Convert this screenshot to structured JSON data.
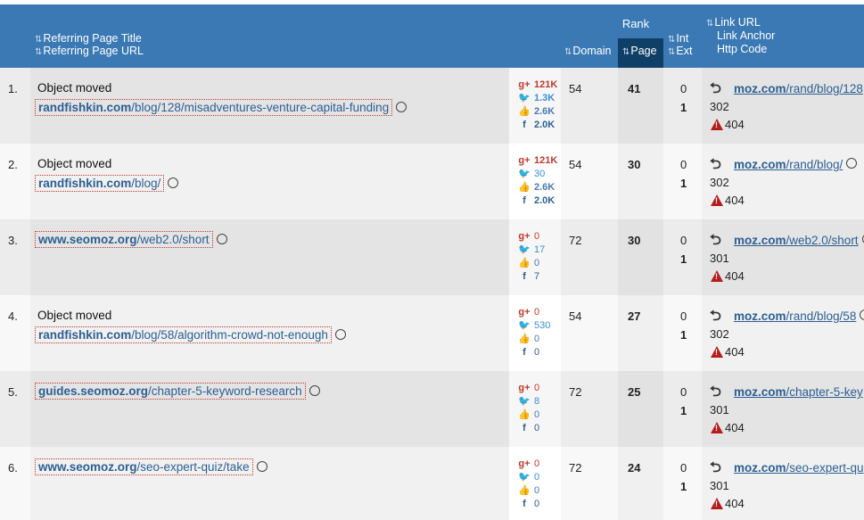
{
  "header": {
    "rank": "Rank",
    "title_label": "Referring Page Title",
    "url_label": "Referring Page URL",
    "domain": "Domain",
    "page": "Page",
    "int": "Int",
    "ext": "Ext",
    "link_url": "Link URL",
    "link_anchor": "Link Anchor",
    "http_code": "Http Code",
    "sort_glyph": "⇅"
  },
  "rows": [
    {
      "num": "1.",
      "title": "Object moved",
      "url_domain": "randfishkin.com",
      "url_path": "/blog/128/misadventures-venture-capital-funding",
      "gplus": "121K",
      "twitter": "1.3K",
      "likes": "2.6K",
      "facebook": "2.0K",
      "domain_rank": "54",
      "page_rank": "41",
      "int": "0",
      "ext": "1",
      "link_domain": "moz.com",
      "link_path": "/rand/blog/128",
      "code": "302",
      "target_code": "404"
    },
    {
      "num": "2.",
      "title": "Object moved",
      "url_domain": "randfishkin.com",
      "url_path": "/blog/",
      "gplus": "121K",
      "twitter": "30",
      "likes": "2.6K",
      "facebook": "2.0K",
      "domain_rank": "54",
      "page_rank": "30",
      "int": "0",
      "ext": "1",
      "link_domain": "moz.com",
      "link_path": "/rand/blog/",
      "code": "302",
      "target_code": "404"
    },
    {
      "num": "3.",
      "title": "",
      "url_domain": "www.seomoz.org",
      "url_path": "/web2.0/short",
      "gplus": "0",
      "twitter": "17",
      "likes": "0",
      "facebook": "7",
      "domain_rank": "72",
      "page_rank": "30",
      "int": "0",
      "ext": "1",
      "link_domain": "moz.com",
      "link_path": "/web2.0/short",
      "code": "301",
      "target_code": "404"
    },
    {
      "num": "4.",
      "title": "Object moved",
      "url_domain": "randfishkin.com",
      "url_path": "/blog/58/algorithm-crowd-not-enough",
      "gplus": "0",
      "twitter": "530",
      "likes": "0",
      "facebook": "0",
      "domain_rank": "54",
      "page_rank": "27",
      "int": "0",
      "ext": "1",
      "link_domain": "moz.com",
      "link_path": "/rand/blog/58",
      "code": "302",
      "target_code": "404"
    },
    {
      "num": "5.",
      "title": "",
      "url_domain": "guides.seomoz.org",
      "url_path": "/chapter-5-keyword-research",
      "gplus": "0",
      "twitter": "8",
      "likes": "0",
      "facebook": "0",
      "domain_rank": "72",
      "page_rank": "25",
      "int": "0",
      "ext": "1",
      "link_domain": "moz.com",
      "link_path": "/chapter-5-key",
      "code": "301",
      "target_code": "404"
    },
    {
      "num": "6.",
      "title": "",
      "url_domain": "www.seomoz.org",
      "url_path": "/seo-expert-quiz/take",
      "gplus": "0",
      "twitter": "0",
      "likes": "0",
      "facebook": "0",
      "domain_rank": "72",
      "page_rank": "24",
      "int": "0",
      "ext": "1",
      "link_domain": "moz.com",
      "link_path": "/seo-expert-qu",
      "code": "301",
      "target_code": "404"
    }
  ],
  "icons": {
    "gplus": "g+",
    "twitter": "🐦",
    "like": "👍",
    "facebook": "f",
    "redirect": "⮌"
  },
  "colors": {
    "header": "#3a79b4",
    "page_sort": "#0f3e66",
    "link": "#2c5f93",
    "social_hot": "#c0392b",
    "warning": "#b71c1c"
  }
}
